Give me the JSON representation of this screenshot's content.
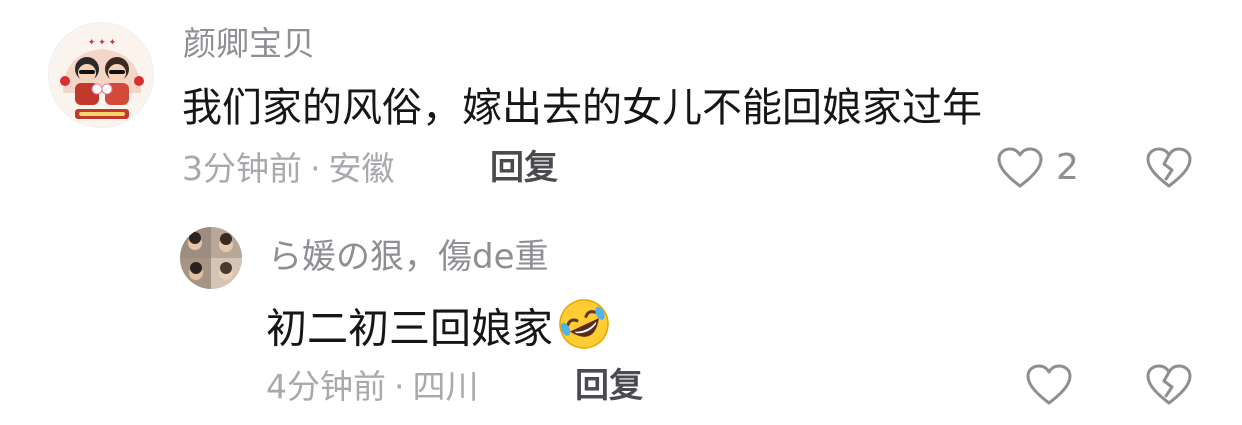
{
  "comments": [
    {
      "username": "颜卿宝贝",
      "text": "我们家的风俗，嫁出去的女儿不能回娘家过年",
      "time": "3分钟前",
      "location": "安徽",
      "reply_label": "回复",
      "likes": "2",
      "avatar_icon": "couple-avatar-icon"
    },
    {
      "username": "ら媛の狠，傷de重",
      "text": "初二初三回娘家",
      "emoji": "rolling-on-floor-laughing-emoji",
      "time": "4分钟前",
      "location": "四川",
      "reply_label": "回复",
      "likes": "",
      "avatar_icon": "group-photo-avatar-icon"
    }
  ],
  "meta_separator": "·",
  "colors": {
    "username": "#8e8e93",
    "content": "#161616",
    "meta": "#a8a8ad",
    "reply_button": "#4a4a4f",
    "icon_stroke": "#8e8e93"
  }
}
